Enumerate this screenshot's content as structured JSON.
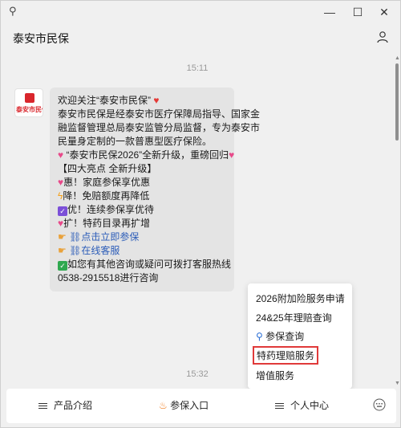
{
  "window": {
    "pin_glyph": "⚲",
    "minimize_glyph": "—",
    "maximize_glyph": "☐",
    "close_glyph": "✕"
  },
  "header": {
    "title": "泰安市民保"
  },
  "chat": {
    "timestamps": [
      "15:11",
      "15:32"
    ],
    "avatar_text": "泰安市民保",
    "message": {
      "greeting": "欢迎关注“泰安市民保”",
      "intro_lines": [
        "泰安市民保是经泰安市医疗保障局指导、国家金",
        "融监督管理总局泰安监管分局监督，专为泰安市",
        "民量身定制的一款普惠型医疗保险。"
      ],
      "upgrade": "“泰安市民保2026”全新升级，重磅回归",
      "highlights_title": "【四大亮点 全新升级】",
      "highlights": [
        "惠！家庭参保享优惠",
        "降！免赔额度再降低",
        "优！连续参保享优待",
        "扩！特药目录再扩增"
      ],
      "link_enroll": "点击立即参保",
      "link_service": "在线客服",
      "contact_line1": "如您有其他咨询或疑问可拨打客服热线",
      "contact_line2": "0538-2915518进行咨询"
    }
  },
  "popup_menu": {
    "items": [
      "2026附加险服务申请",
      "24&25年理赔查询",
      "参保查询",
      "特药理赔服务",
      "增值服务"
    ],
    "highlighted_index": 3
  },
  "bottom_bar": {
    "tabs": [
      "产品介绍",
      "参保入口",
      "个人中心"
    ]
  },
  "colors": {
    "highlight_border": "#e03a3a",
    "link": "#2b5cb8",
    "bubble_bg": "#e4e4e4"
  }
}
